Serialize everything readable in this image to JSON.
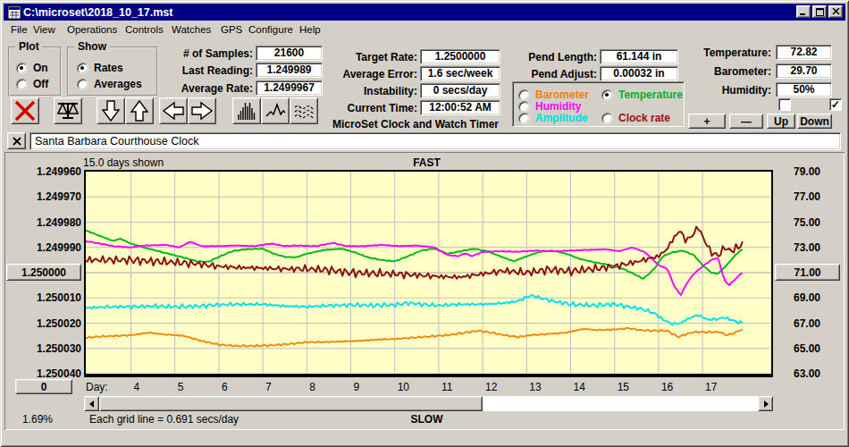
{
  "window": {
    "title": "C:\\microset\\2018_10_17.mst"
  },
  "menu": {
    "items": [
      "File",
      "View",
      "Operations",
      "Controls",
      "Watches",
      "GPS",
      "Configure",
      "Help"
    ]
  },
  "plot_group": {
    "caption": "Plot",
    "options": [
      {
        "label": "On",
        "selected": true
      },
      {
        "label": "Off",
        "selected": false
      }
    ]
  },
  "show_group": {
    "caption": "Show",
    "options": [
      {
        "label": "Rates",
        "selected": true
      },
      {
        "label": "Averages",
        "selected": false
      }
    ]
  },
  "stats_left": {
    "rows": [
      {
        "label": "# of Samples:",
        "value": "21600"
      },
      {
        "label": "Last Reading:",
        "value": "1.249989"
      },
      {
        "label": "Average Rate:",
        "value": "1.2499967"
      }
    ]
  },
  "stats_mid": {
    "rows": [
      {
        "label": "Target Rate:",
        "value": "1.2500000"
      },
      {
        "label": "Average Error:",
        "value": "1.6 sec/week"
      },
      {
        "label": "Instability:",
        "value": "0 secs/day"
      },
      {
        "label": "Current Time:",
        "value": "12:00:52 AM"
      }
    ],
    "app_caption": "MicroSet Clock and Watch Timer"
  },
  "pendulum": {
    "rows": [
      {
        "label": "Pend Length:",
        "value": "61.144 in"
      },
      {
        "label": "Pend Adjust:",
        "value": "0.00032 in"
      }
    ]
  },
  "sensor_group": {
    "options": [
      {
        "label": "Barometer",
        "color": "#f08000",
        "selected": false
      },
      {
        "label": "Humidity",
        "color": "#ff00ff",
        "selected": false
      },
      {
        "label": "Amplitude",
        "color": "#00dcdc",
        "selected": false
      },
      {
        "label": "Temperature",
        "color": "#00b41e",
        "selected": true
      },
      {
        "label": "Clock rate",
        "color": "#9b1010",
        "selected": false
      }
    ]
  },
  "env": {
    "rows": [
      {
        "label": "Temperature:",
        "value": "72.82"
      },
      {
        "label": "Barometer:",
        "value": "29.70"
      },
      {
        "label": "Humidity:",
        "value": "50%"
      }
    ],
    "checkboxes": [
      {
        "checked": false
      },
      {
        "checked": true
      }
    ],
    "buttons": [
      "+",
      "—",
      "Up",
      "Down"
    ]
  },
  "toolbar": {
    "buttons": [
      "delete",
      "balance",
      "down",
      "up",
      "left",
      "right",
      "histogram",
      "wave",
      "smooth"
    ]
  },
  "series_field": {
    "value": "Santa Barbara Courthouse Clock"
  },
  "chart_data": {
    "type": "line",
    "days_shown_label": "15.0 days shown",
    "fast_label": "FAST",
    "slow_label": "SLOW",
    "percent_label": "1.69%",
    "grid_note": "Each grid line = 0.691 secs/day",
    "zero_button": "0",
    "x_axis": {
      "label": "Day:",
      "ticks": [
        4,
        5,
        6,
        7,
        8,
        9,
        10,
        11,
        12,
        13,
        14,
        15,
        16,
        17
      ],
      "day_start": 2.96,
      "day_end": 17.95
    },
    "y_left": {
      "labels": [
        "1.249960",
        "1.249970",
        "1.249980",
        "1.249990",
        "1.250000",
        "1.250010",
        "1.250020",
        "1.250030",
        "1.250040"
      ],
      "button_index": 4
    },
    "y_right": {
      "labels": [
        "79.00",
        "77.00",
        "75.00",
        "73.00",
        "71.00",
        "69.00",
        "67.00",
        "65.00",
        "63.00"
      ],
      "button_index": 4,
      "top_value": 79,
      "bottom_value": 63
    },
    "plot_bg": "#ffffc8",
    "grid_color": "#c0c0c0",
    "center_grid_color": "#a8a8a8",
    "scrollbar": {
      "thumb_start_frac": 0.0,
      "thumb_end_frac": 0.582
    },
    "series": [
      {
        "name": "Barometer",
        "color": "#f08c14",
        "jitter": 1.2,
        "phase": 1.3,
        "points": [
          [
            2.97,
            65.85
          ],
          [
            3.3,
            65.95
          ],
          [
            3.7,
            66.0
          ],
          [
            4,
            66.05
          ],
          [
            4.4,
            66.25
          ],
          [
            4.8,
            66.1
          ],
          [
            5.2,
            66.0
          ],
          [
            5.6,
            65.6
          ],
          [
            6,
            65.3
          ],
          [
            6.4,
            65.2
          ],
          [
            6.8,
            65.2
          ],
          [
            7.2,
            65.25
          ],
          [
            7.6,
            65.35
          ],
          [
            8,
            65.5
          ],
          [
            8.4,
            65.5
          ],
          [
            8.8,
            65.55
          ],
          [
            9.2,
            65.6
          ],
          [
            9.6,
            65.7
          ],
          [
            10,
            65.75
          ],
          [
            10.4,
            65.85
          ],
          [
            10.8,
            65.95
          ],
          [
            11.2,
            66.05
          ],
          [
            11.6,
            66.25
          ],
          [
            11.9,
            66.4
          ],
          [
            12.2,
            66.25
          ],
          [
            12.5,
            66.05
          ],
          [
            12.8,
            65.9
          ],
          [
            13.1,
            66.05
          ],
          [
            13.5,
            66.15
          ],
          [
            13.9,
            66.25
          ],
          [
            14.3,
            66.55
          ],
          [
            14.6,
            66.45
          ],
          [
            15,
            66.5
          ],
          [
            15.3,
            66.6
          ],
          [
            15.6,
            66.45
          ],
          [
            15.9,
            66.4
          ],
          [
            16.2,
            66.4
          ],
          [
            16.45,
            65.9
          ],
          [
            16.6,
            66.1
          ],
          [
            16.8,
            66.3
          ],
          [
            17.1,
            66.3
          ],
          [
            17.4,
            66.3
          ],
          [
            17.55,
            66.05
          ],
          [
            17.7,
            66.2
          ],
          [
            17.9,
            66.5
          ]
        ]
      },
      {
        "name": "Amplitude",
        "color": "#00e0e8",
        "jitter": 2.8,
        "phase": 2.1,
        "points": [
          [
            2.97,
            68.2
          ],
          [
            3.5,
            68.3
          ],
          [
            4,
            68.3
          ],
          [
            4.5,
            68.35
          ],
          [
            5,
            68.3
          ],
          [
            5.5,
            68.35
          ],
          [
            6,
            68.45
          ],
          [
            6.5,
            68.5
          ],
          [
            7,
            68.5
          ],
          [
            7.5,
            68.35
          ],
          [
            8,
            68.3
          ],
          [
            8.5,
            68.4
          ],
          [
            9,
            68.45
          ],
          [
            9.5,
            68.4
          ],
          [
            10,
            68.45
          ],
          [
            10.3,
            68.6
          ],
          [
            10.6,
            68.5
          ],
          [
            11,
            68.4
          ],
          [
            11.5,
            68.5
          ],
          [
            12,
            68.5
          ],
          [
            12.5,
            68.6
          ],
          [
            12.8,
            68.75
          ],
          [
            13.1,
            69.2
          ],
          [
            13.3,
            69.0
          ],
          [
            13.6,
            68.75
          ],
          [
            14,
            68.5
          ],
          [
            14.5,
            68.4
          ],
          [
            15,
            68.5
          ],
          [
            15.3,
            68.3
          ],
          [
            15.6,
            68.15
          ],
          [
            15.9,
            67.8
          ],
          [
            16.1,
            67.3
          ],
          [
            16.3,
            66.95
          ],
          [
            16.5,
            67.0
          ],
          [
            16.7,
            67.4
          ],
          [
            16.9,
            67.65
          ],
          [
            17.1,
            67.3
          ],
          [
            17.3,
            67.3
          ],
          [
            17.5,
            67.45
          ],
          [
            17.7,
            67.2
          ],
          [
            17.9,
            67.0
          ]
        ]
      },
      {
        "name": "Temperature",
        "color": "#00b818",
        "jitter": 0.6,
        "phase": 3.7,
        "points": [
          [
            2.97,
            74.35
          ],
          [
            3.3,
            73.9
          ],
          [
            3.6,
            73.5
          ],
          [
            3.75,
            73.7
          ],
          [
            4,
            73.3
          ],
          [
            4.4,
            72.9
          ],
          [
            4.8,
            72.55
          ],
          [
            5.2,
            72.2
          ],
          [
            5.5,
            71.9
          ],
          [
            5.75,
            71.85
          ],
          [
            6,
            72.25
          ],
          [
            6.3,
            72.7
          ],
          [
            6.6,
            72.85
          ],
          [
            7,
            72.9
          ],
          [
            7.25,
            72.5
          ],
          [
            7.5,
            72.25
          ],
          [
            7.75,
            72.2
          ],
          [
            8,
            72.5
          ],
          [
            8.4,
            72.8
          ],
          [
            8.8,
            72.9
          ],
          [
            9.1,
            72.6
          ],
          [
            9.4,
            72.2
          ],
          [
            9.7,
            72.0
          ],
          [
            10,
            71.9
          ],
          [
            10.3,
            72.3
          ],
          [
            10.6,
            72.75
          ],
          [
            10.9,
            72.9
          ],
          [
            11.2,
            72.5
          ],
          [
            11.5,
            72.7
          ],
          [
            11.8,
            72.9
          ],
          [
            12.1,
            72.7
          ],
          [
            12.4,
            72.3
          ],
          [
            12.7,
            71.9
          ],
          [
            13,
            72.3
          ],
          [
            13.3,
            72.65
          ],
          [
            13.6,
            72.75
          ],
          [
            13.9,
            72.5
          ],
          [
            14.2,
            72.1
          ],
          [
            14.5,
            71.85
          ],
          [
            14.9,
            71.6
          ],
          [
            15.2,
            71.3
          ],
          [
            15.5,
            70.8
          ],
          [
            15.65,
            70.5
          ],
          [
            15.9,
            71.3
          ],
          [
            16.1,
            72.3
          ],
          [
            16.3,
            72.6
          ],
          [
            16.55,
            72.75
          ],
          [
            16.8,
            72.4
          ],
          [
            17,
            71.6
          ],
          [
            17.2,
            71.0
          ],
          [
            17.35,
            70.9
          ],
          [
            17.55,
            71.6
          ],
          [
            17.75,
            72.4
          ],
          [
            17.9,
            72.85
          ]
        ]
      },
      {
        "name": "Humidity",
        "color": "#ff00ff",
        "jitter": 0.45,
        "phase": 4.9,
        "points": [
          [
            2.97,
            73.5
          ],
          [
            3.3,
            73.3
          ],
          [
            3.6,
            73.1
          ],
          [
            4,
            73.0
          ],
          [
            4.3,
            73.15
          ],
          [
            4.8,
            73.2
          ],
          [
            5.1,
            73.0
          ],
          [
            5.35,
            73.45
          ],
          [
            5.6,
            73.1
          ],
          [
            6,
            73.1
          ],
          [
            6.4,
            73.15
          ],
          [
            6.8,
            73.1
          ],
          [
            7.2,
            73.3
          ],
          [
            7.5,
            73.1
          ],
          [
            7.8,
            73.15
          ],
          [
            8.2,
            73.1
          ],
          [
            8.6,
            73.35
          ],
          [
            8.9,
            73.1
          ],
          [
            9.3,
            73.1
          ],
          [
            9.7,
            73.2
          ],
          [
            10.1,
            73.1
          ],
          [
            10.5,
            73.15
          ],
          [
            10.9,
            73.0
          ],
          [
            11.2,
            72.4
          ],
          [
            11.45,
            72.3
          ],
          [
            11.6,
            72.55
          ],
          [
            11.75,
            72.3
          ],
          [
            12,
            72.65
          ],
          [
            12.4,
            72.7
          ],
          [
            12.8,
            72.65
          ],
          [
            13.2,
            72.75
          ],
          [
            13.6,
            72.7
          ],
          [
            14,
            72.75
          ],
          [
            14.4,
            72.8
          ],
          [
            14.8,
            72.85
          ],
          [
            15.1,
            72.7
          ],
          [
            15.4,
            73.0
          ],
          [
            15.7,
            72.6
          ],
          [
            16,
            71.6
          ],
          [
            16.2,
            71.3
          ],
          [
            16.35,
            70.0
          ],
          [
            16.5,
            69.2
          ],
          [
            16.65,
            70.2
          ],
          [
            16.8,
            70.9
          ],
          [
            17,
            71.5
          ],
          [
            17.2,
            72.0
          ],
          [
            17.35,
            72.2
          ],
          [
            17.5,
            70.4
          ],
          [
            17.6,
            70.0
          ],
          [
            17.75,
            70.5
          ],
          [
            17.9,
            71.0
          ]
        ]
      },
      {
        "name": "Clock rate",
        "color": "#8e1212",
        "jitter": 5.5,
        "phase": 0.4,
        "points": [
          [
            2.97,
            72.0
          ],
          [
            3.5,
            72.0
          ],
          [
            4,
            72.0
          ],
          [
            4.5,
            71.9
          ],
          [
            5,
            71.8
          ],
          [
            5.5,
            71.7
          ],
          [
            6,
            71.5
          ],
          [
            6.5,
            71.4
          ],
          [
            7,
            71.35
          ],
          [
            7.5,
            71.3
          ],
          [
            8,
            71.3
          ],
          [
            8.5,
            71.2
          ],
          [
            9,
            71.0
          ],
          [
            9.5,
            70.95
          ],
          [
            10,
            70.9
          ],
          [
            10.5,
            70.8
          ],
          [
            11,
            70.7
          ],
          [
            11.5,
            70.65
          ],
          [
            12,
            70.9
          ],
          [
            12.5,
            71.15
          ],
          [
            13,
            71.0
          ],
          [
            13.5,
            71.25
          ],
          [
            14,
            71.1
          ],
          [
            14.5,
            71.3
          ],
          [
            15,
            71.5
          ],
          [
            15.5,
            71.85
          ],
          [
            16,
            72.3
          ],
          [
            16.2,
            72.9
          ],
          [
            16.35,
            73.8
          ],
          [
            16.5,
            74.35
          ],
          [
            16.62,
            73.5
          ],
          [
            16.78,
            74.0
          ],
          [
            16.9,
            74.65
          ],
          [
            17.05,
            73.5
          ],
          [
            17.2,
            72.6
          ],
          [
            17.35,
            72.3
          ],
          [
            17.5,
            73.0
          ],
          [
            17.65,
            72.7
          ],
          [
            17.8,
            73.0
          ],
          [
            17.9,
            73.3
          ]
        ]
      }
    ]
  }
}
